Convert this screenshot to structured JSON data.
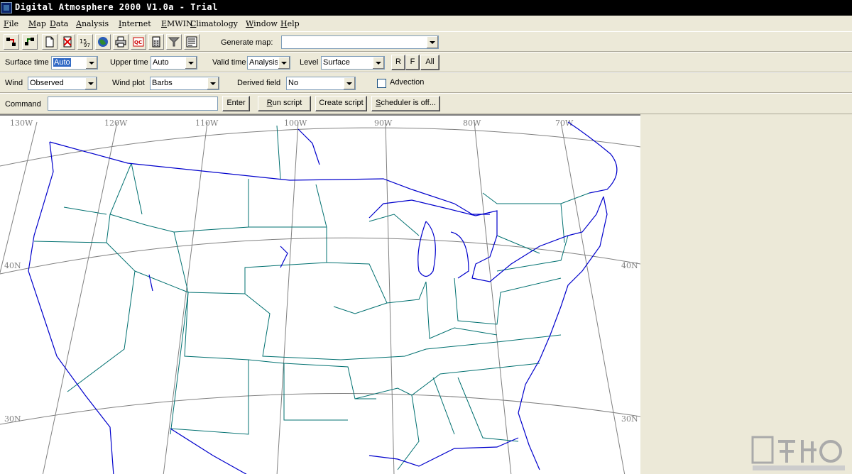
{
  "window": {
    "title": "Digital Atmosphere 2000 V1.0a - Trial"
  },
  "menu": [
    "File",
    "Map",
    "Data",
    "Analysis",
    "Internet",
    "EMWIN",
    "Climatology",
    "Window",
    "Help"
  ],
  "toolbar": {
    "generate_map_label": "Generate map:",
    "generate_map_value": ""
  },
  "row1": {
    "surface_time_label": "Surface time",
    "surface_time_value": "Auto",
    "upper_time_label": "Upper time",
    "upper_time_value": "Auto",
    "valid_time_label": "Valid time",
    "valid_time_value": "Analysis",
    "level_label": "Level",
    "level_value": "Surface",
    "btn_r": "R",
    "btn_f": "F",
    "btn_all": "All"
  },
  "row2": {
    "wind_label": "Wind",
    "wind_value": "Observed",
    "wind_plot_label": "Wind plot",
    "wind_plot_value": "Barbs",
    "derived_field_label": "Derived field",
    "derived_field_value": "No",
    "advection_label": "Advection"
  },
  "row3": {
    "command_label": "Command",
    "command_value": "",
    "enter_label": "Enter",
    "run_script_label": "Run script",
    "create_script_label": "Create script",
    "scheduler_label": "Scheduler is off..."
  },
  "map": {
    "longitudes": [
      "130W",
      "120W",
      "110W",
      "100W",
      "90W",
      "80W",
      "70W"
    ],
    "latitudes_left": [
      "40N",
      "30N"
    ],
    "latitudes_right": [
      "40N",
      "30N"
    ]
  },
  "colors": {
    "coast": "#0000cc",
    "state": "#007070",
    "grid": "#808080",
    "titlebar": "#000000"
  }
}
